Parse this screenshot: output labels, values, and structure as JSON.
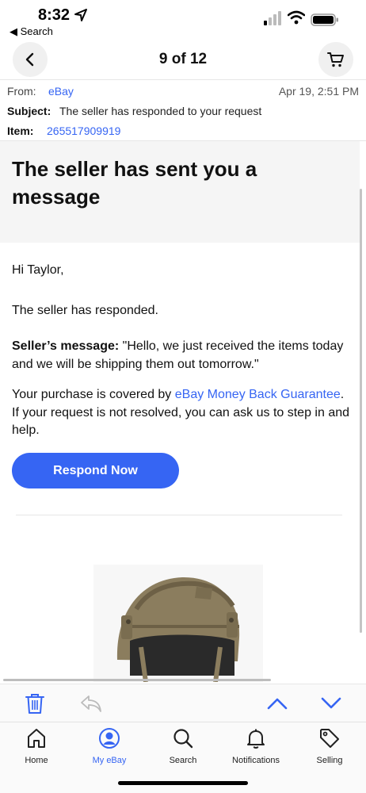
{
  "status_bar": {
    "time": "8:32",
    "back_app": "◀ Search"
  },
  "nav": {
    "title": "9 of 12"
  },
  "header": {
    "from_label": "From:",
    "from_value": "eBay",
    "date": "Apr 19, 2:51 PM",
    "subject_label": "Subject:",
    "subject_value": "The seller has responded to your request",
    "item_label": "Item:",
    "item_value": "265517909919"
  },
  "message": {
    "title": "The seller has sent you a message",
    "greeting": "Hi Taylor,",
    "responded": "The seller has responded.",
    "seller_label": "Seller’s message:",
    "seller_text": " \"Hello, we just received the items today and we will be shipping them out tomorrow.\"",
    "covered_pre": "Your purchase is covered by ",
    "covered_link": "eBay Money Back Guarantee",
    "covered_post": ". If your request is not resolved, you can ask us to step in and help.",
    "button": "Respond Now"
  },
  "tabs": [
    {
      "label": "Home",
      "icon": "home-icon",
      "active": false
    },
    {
      "label": "My eBay",
      "icon": "profile-icon",
      "active": true
    },
    {
      "label": "Search",
      "icon": "search-icon",
      "active": false
    },
    {
      "label": "Notifications",
      "icon": "bell-icon",
      "active": false
    },
    {
      "label": "Selling",
      "icon": "tag-icon",
      "active": false
    }
  ],
  "colors": {
    "accent": "#3665f3",
    "banner_bg": "#f5f5f5",
    "helmet": "#8b7d5e"
  }
}
